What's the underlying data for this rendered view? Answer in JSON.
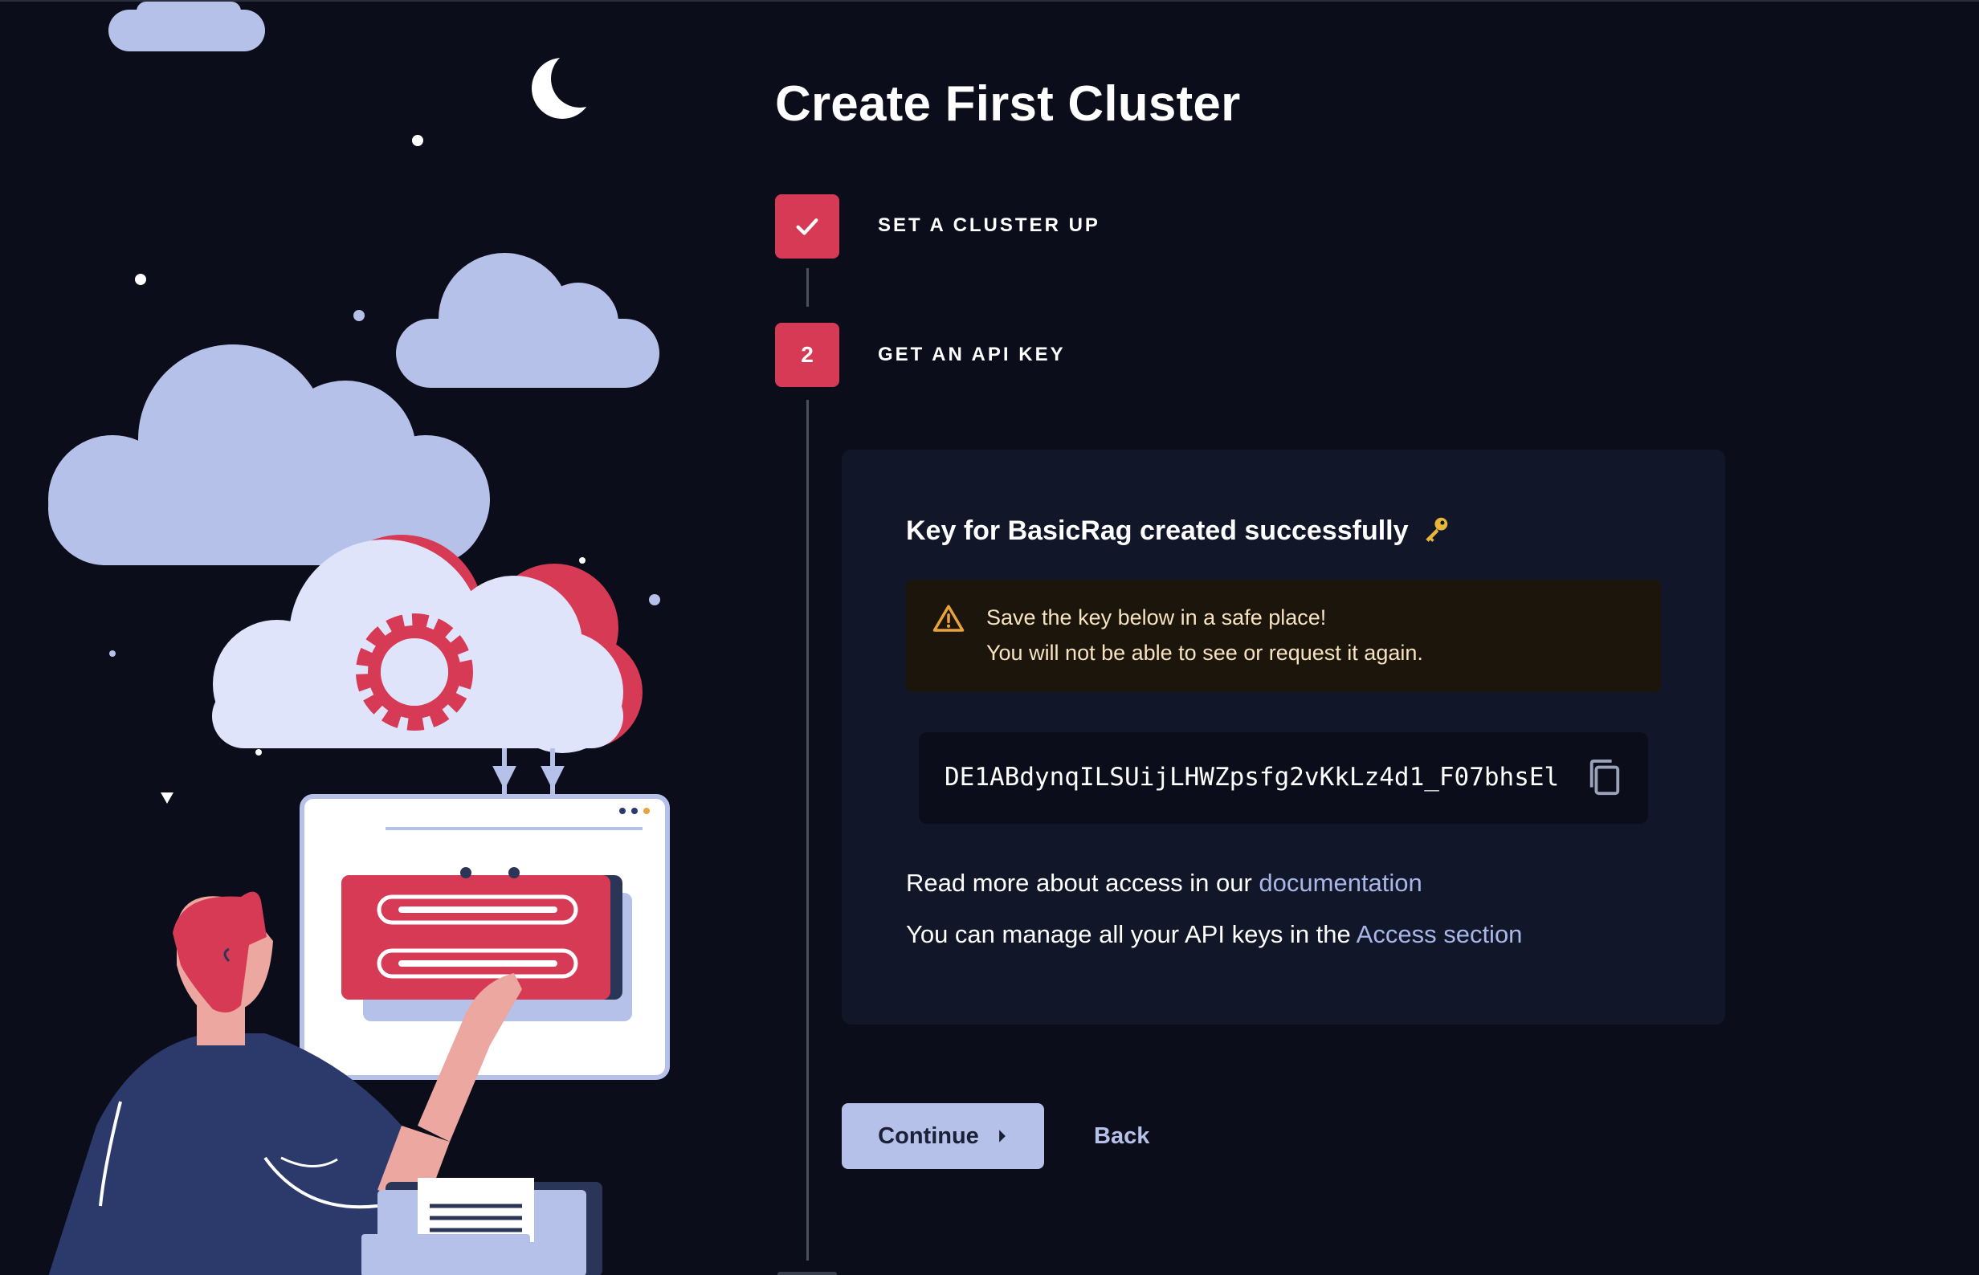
{
  "page": {
    "title": "Create First Cluster"
  },
  "steps": [
    {
      "badge": "",
      "icon": "check-icon",
      "label": "SET A CLUSTER UP",
      "status": "completed"
    },
    {
      "badge": "2",
      "label": "GET AN API KEY",
      "status": "active"
    }
  ],
  "card": {
    "heading": "Key for BasicRag created successfully",
    "heading_icon": "key-icon",
    "warning": {
      "icon": "warning-triangle-icon",
      "line1": "Save the key below in a safe place!",
      "line2": "You will not be able to see or request it again."
    },
    "api_key": {
      "value": "DE1ABdynqILSUijLHWZpsfg2vKkLz4d1_F07bhsEl",
      "copy_icon": "copy-icon"
    },
    "docs_line": {
      "prefix": "Read more about access in our",
      "link": "documentation"
    },
    "access_line": {
      "prefix": "You can manage all your API keys in the",
      "link": "Access section"
    }
  },
  "actions": {
    "continue_label": "Continue",
    "continue_icon": "caret-right-icon",
    "back_label": "Back"
  },
  "colors": {
    "background": "#0b0e1a",
    "accent": "#d63a55",
    "card": "#111728",
    "link": "#a9b6e8",
    "button": "#b6c1ea",
    "warning_bg": "#1b150c",
    "warning_icon": "#e8a33c"
  }
}
